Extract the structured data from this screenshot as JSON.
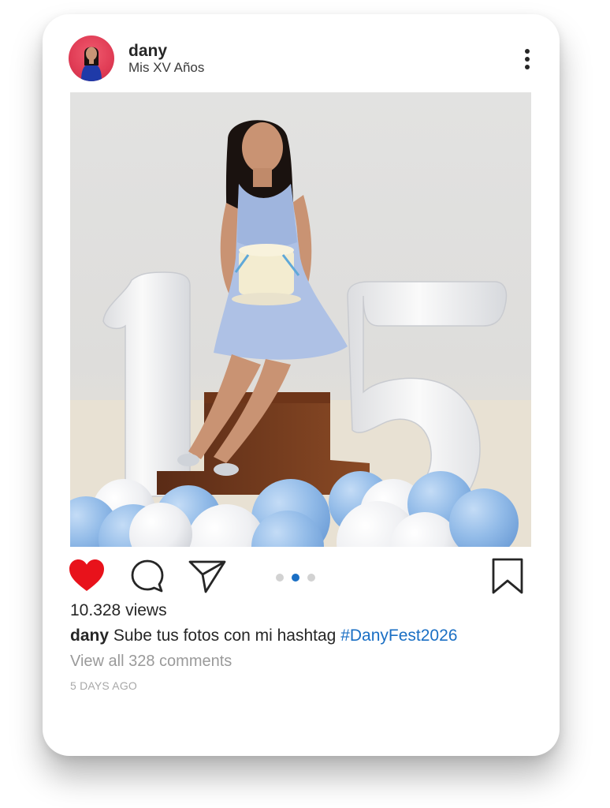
{
  "post": {
    "username": "dany",
    "location": "Mis XV Años",
    "views": "10.328 views",
    "caption_user": "dany",
    "caption_text": " Sube tus fotos con mi hashtag ",
    "hashtag": "#DanyFest2026",
    "view_comments": "View all 328 comments",
    "timestamp": "5 DAYS AGO",
    "liked": true,
    "carousel": {
      "count": 3,
      "active_index": 1
    }
  },
  "icons": {
    "more": "more-vertical-icon",
    "like": "heart-icon",
    "comment": "comment-bubble-icon",
    "share": "send-icon",
    "save": "bookmark-icon"
  },
  "colors": {
    "like": "#e8121b",
    "hashtag": "#1a6fc4",
    "carousel_active": "#1a6fc4",
    "carousel_inactive": "#d2d2d2",
    "avatar_bg": "#e03c55",
    "dress": "#a9bde3",
    "balloon_blue": "#8fb8e6"
  }
}
